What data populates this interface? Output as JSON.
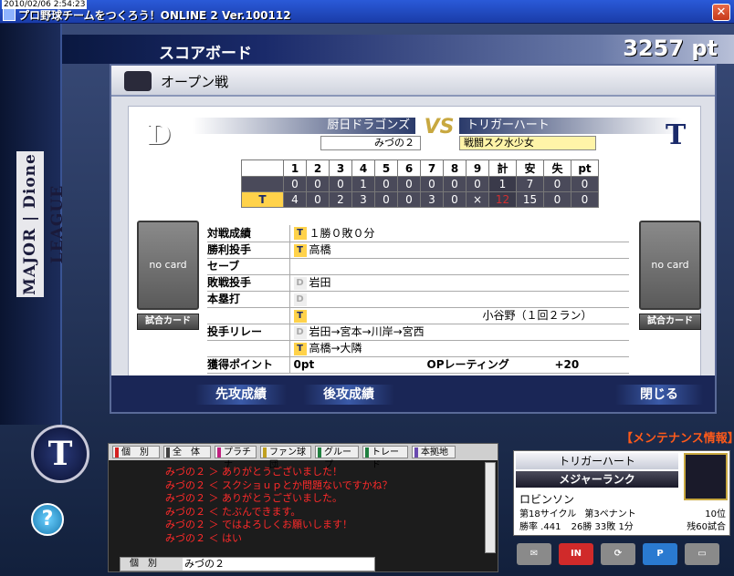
{
  "window": {
    "timestamp": "2010/02/06 2:54:23",
    "title": "プロ野球チームをつくろう！ONLINE 2 Ver.100112"
  },
  "header": {
    "title": "スコアボード",
    "points": "3257 pt"
  },
  "league": "MAJOR | Dione LEAGUE",
  "panel": {
    "title": "オープン戦",
    "home": {
      "team": "厨日ドラゴンズ",
      "player": "みづの２",
      "logo": "D"
    },
    "vs": "VS",
    "away": {
      "team": "トリガーハート",
      "player": "戦闘スク水少女",
      "logo": "T"
    },
    "score_header": [
      "1",
      "2",
      "3",
      "4",
      "5",
      "6",
      "7",
      "8",
      "9",
      "計",
      "安",
      "失",
      "pt"
    ],
    "score_rows": [
      {
        "team": "",
        "cells": [
          "0",
          "0",
          "0",
          "1",
          "0",
          "0",
          "0",
          "0",
          "0",
          "1",
          "7",
          "0",
          "0"
        ]
      },
      {
        "team": "T",
        "cells": [
          "4",
          "0",
          "2",
          "3",
          "0",
          "0",
          "3",
          "0",
          "×",
          "12",
          "15",
          "0",
          "0"
        ]
      }
    ],
    "results": [
      {
        "label": "対戦成績",
        "icon": "T",
        "value": "１勝０敗０分"
      },
      {
        "label": "勝利投手",
        "icon": "T",
        "value": "高橋"
      },
      {
        "label": "セーブ",
        "icon": "",
        "value": ""
      },
      {
        "label": "敗戦投手",
        "icon": "D",
        "value": "岩田"
      },
      {
        "label": "本塁打",
        "icon": "D",
        "value": ""
      },
      {
        "label": "",
        "icon": "T",
        "value": "小谷野（１回２ラン）"
      },
      {
        "label": "投手リレー",
        "icon": "D",
        "value": "岩田→宮本→川岸→宮西"
      },
      {
        "label": "",
        "icon": "T",
        "value": "高橋→大隣"
      }
    ],
    "points_label": "獲得ポイント",
    "points_value": "0pt",
    "rating_label": "OPレーティング",
    "rating_value": "+20",
    "no_card": "no card",
    "card_button": "試合カード",
    "buttons": {
      "first": "先攻成績",
      "second": "後攻成績",
      "close": "閉じる"
    }
  },
  "maintenance": "【メンテナンス情報】",
  "chat": {
    "tabs": [
      "個　別",
      "全　体",
      "プラチナ",
      "ファン球団",
      "グループ",
      "トレード",
      "本拠地"
    ],
    "tab_colors": [
      "#d42020",
      "#404040",
      "#c02080",
      "#c0a020",
      "#208040",
      "#208040",
      "#6a4ab0"
    ],
    "log": [
      "みづの２ ＞ ありがとうございました！",
      "みづの２ ＜ スクショｕｐとか問題ないですかね？",
      "みづの２ ＞ ありがとうございました。",
      "みづの２ ＜ たぶんできます。",
      "みづの２ ＞ ではよろしくお願いします！",
      "みづの２ ＜ はい"
    ],
    "input_target": "個　別",
    "input_value": "みづの２"
  },
  "profile": {
    "team": "トリガーハート",
    "rank": "メジャーランク",
    "name": "ロビンソン",
    "cycle": "第18サイクル",
    "pennant": "第3ペナント",
    "position": "10位",
    "win_rate": "勝率 .441",
    "record": "26勝 33敗 1分",
    "remaining": "残60試合"
  },
  "icons": [
    "mail-icon",
    "in-icon",
    "refresh-icon",
    "p-icon",
    "result-icon"
  ]
}
